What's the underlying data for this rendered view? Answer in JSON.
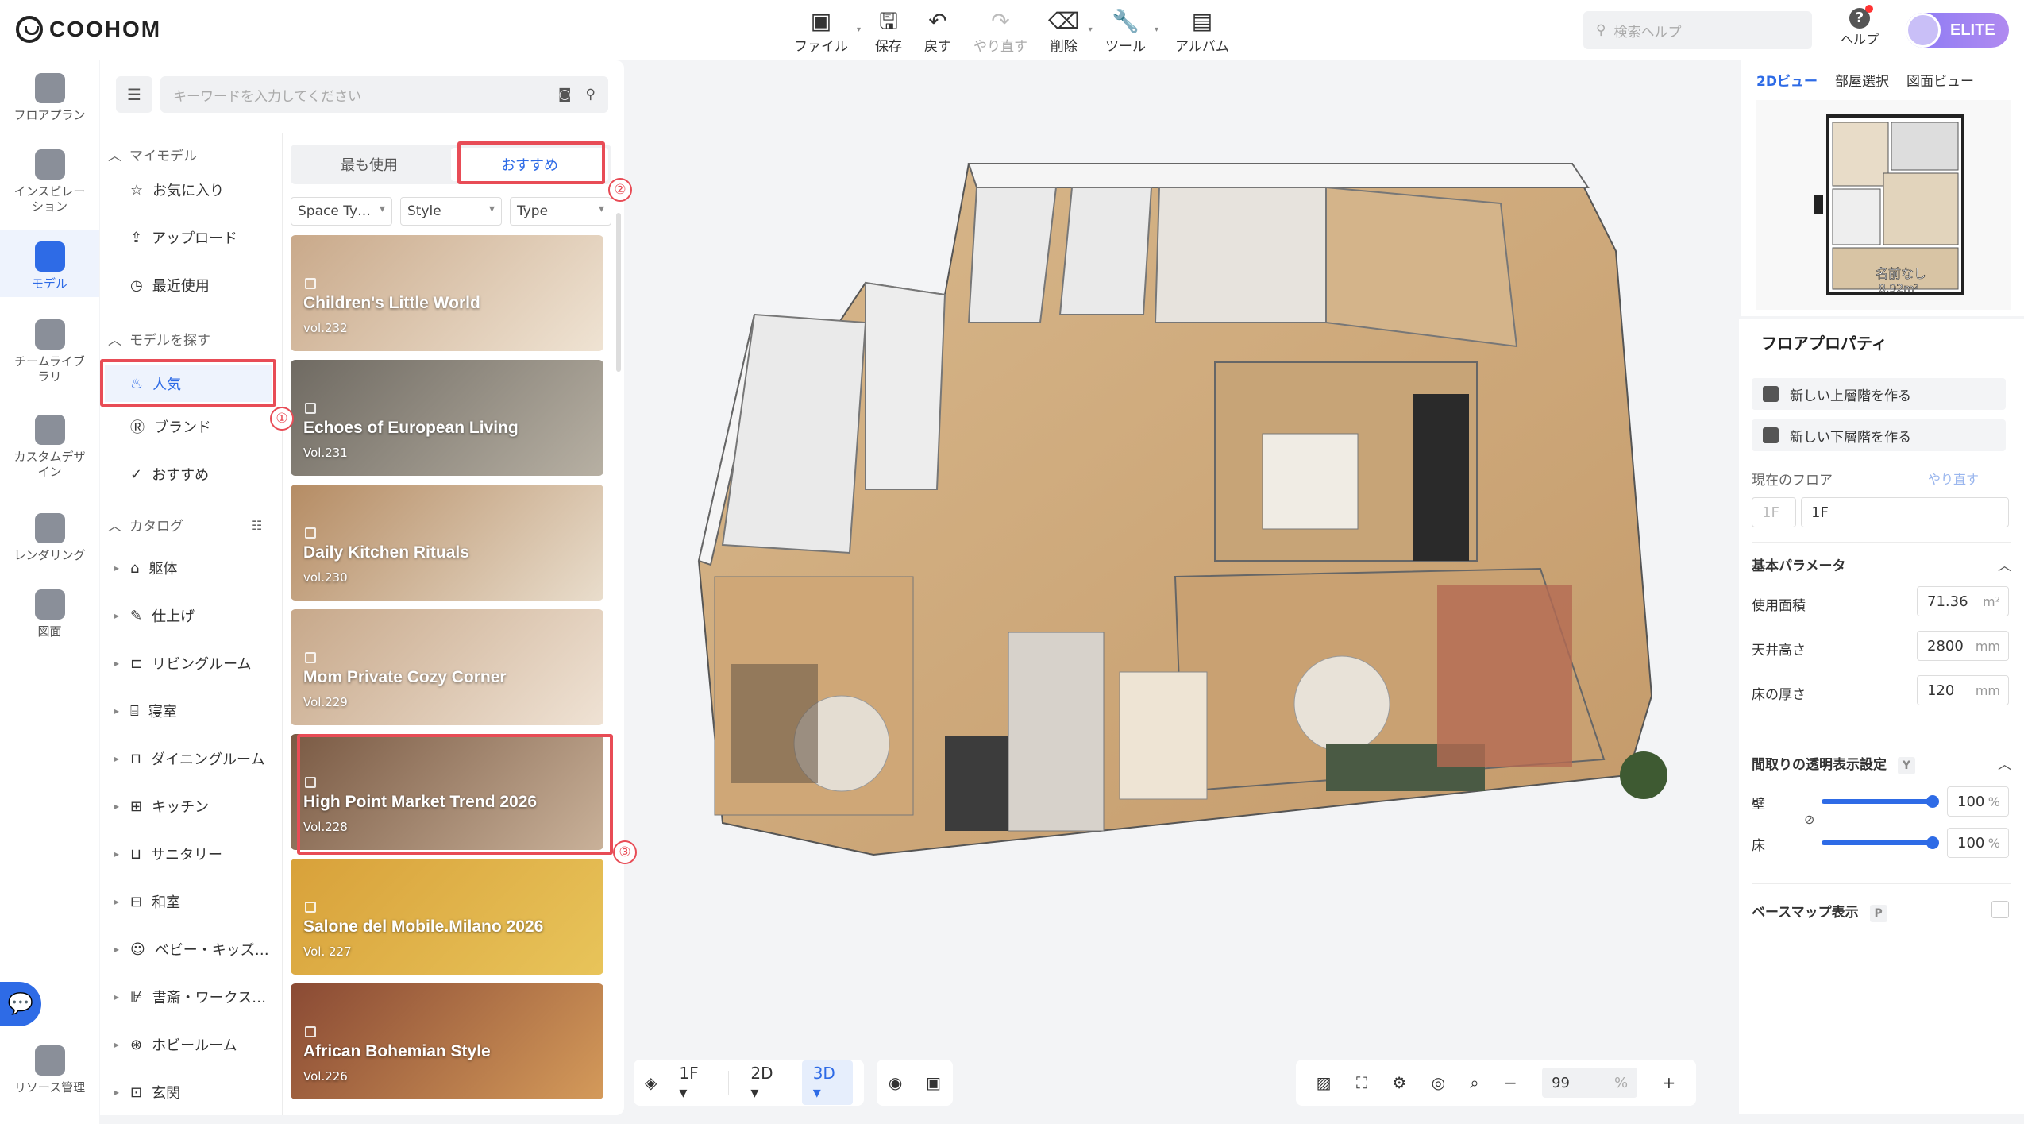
{
  "app": {
    "logo_text": "COOHOM"
  },
  "toolbar": {
    "file": "ファイル",
    "save": "保存",
    "undo": "戻す",
    "redo": "やり直す",
    "delete": "削除",
    "tools": "ツール",
    "album": "アルバム"
  },
  "header": {
    "search_placeholder": "検索ヘルプ",
    "help": "ヘルプ",
    "plan_badge": "ELITE"
  },
  "rail": [
    {
      "label": "フロアプラン"
    },
    {
      "label": "インスピレーション"
    },
    {
      "label": "モデル"
    },
    {
      "label": "チームライブラリ"
    },
    {
      "label": "カスタムデザイン"
    },
    {
      "label": "レンダリング"
    },
    {
      "label": "図面"
    },
    {
      "label": "リソース管理"
    }
  ],
  "panel": {
    "search_placeholder": "キーワードを入力してください",
    "my_models": "マイモデル",
    "favorites": "お気に入り",
    "upload": "アップロード",
    "recent": "最近使用",
    "find_models": "モデルを探す",
    "popular": "人気",
    "brand": "ブランド",
    "recommended": "おすすめ",
    "catalog": "カタログ",
    "catalog_items": [
      "躯体",
      "仕上げ",
      "リビングルーム",
      "寝室",
      "ダイニングルーム",
      "キッチン",
      "サニタリー",
      "和室",
      "ベビー・キッズ…",
      "書斎・ワークス…",
      "ホビールーム",
      "玄関"
    ],
    "tabs": {
      "most_used": "最も使用",
      "recommended": "おすすめ"
    },
    "filters": [
      "Space Ty…",
      "Style",
      "Type"
    ],
    "cards": [
      {
        "title": "Children's Little World",
        "vol": "vol.232",
        "c1": "#c9a98a",
        "c2": "#efe3d3"
      },
      {
        "title": "Echoes of European Living",
        "vol": "Vol.231",
        "c1": "#6f6a62",
        "c2": "#b7b0a3"
      },
      {
        "title": "Daily Kitchen Rituals",
        "vol": "vol.230",
        "c1": "#b58c64",
        "c2": "#e9ddcc"
      },
      {
        "title": "Mom Private Cozy Corner",
        "vol": "Vol.229",
        "c1": "#c7a88a",
        "c2": "#efe2d4"
      },
      {
        "title": "High Point Market Trend 2026",
        "vol": "Vol.228",
        "c1": "#7a5a44",
        "c2": "#c9b199"
      },
      {
        "title": "Salone del Mobile.Milano 2026",
        "vol": "Vol. 227",
        "c1": "#d8a13a",
        "c2": "#e8c45a"
      },
      {
        "title": "African Bohemian Style",
        "vol": "Vol.226",
        "c1": "#8a4a34",
        "c2": "#d49a5a"
      }
    ],
    "annotations": [
      "①",
      "②",
      "③"
    ]
  },
  "bottom": {
    "floor": "1F",
    "view2d": "2D",
    "view3d": "3D",
    "zoom": "99",
    "zoom_unit": "%"
  },
  "right": {
    "tabs": [
      "2Dビュー",
      "部屋選択",
      "図面ビュー"
    ],
    "mini_label": "名前なし",
    "mini_area": "8.92m²",
    "title": "フロアプロパティ",
    "new_upper": "新しい上層階を作る",
    "new_lower": "新しい下層階を作る",
    "current_floor": "現在のフロア",
    "redo_link": "やり直す",
    "floor_prefix": "1F",
    "floor_value": "1F",
    "basic_params": "基本パラメータ",
    "area_label": "使用面積",
    "area_value": "71.36",
    "area_unit": "m²",
    "ceiling_label": "天井高さ",
    "ceiling_value": "2800",
    "ceiling_unit": "mm",
    "floor_thick_label": "床の厚さ",
    "floor_thick_value": "120",
    "floor_thick_unit": "mm",
    "transparency": "間取りの透明表示設定",
    "transparency_key": "Y",
    "wall_label": "壁",
    "wall_value": "100",
    "floor_label": "床",
    "floor_opacity_value": "100",
    "pct": "%",
    "basemap": "ベースマップ表示",
    "basemap_key": "P"
  },
  "colors": {
    "accent": "#2e6be6",
    "annotation": "#e84c56"
  }
}
